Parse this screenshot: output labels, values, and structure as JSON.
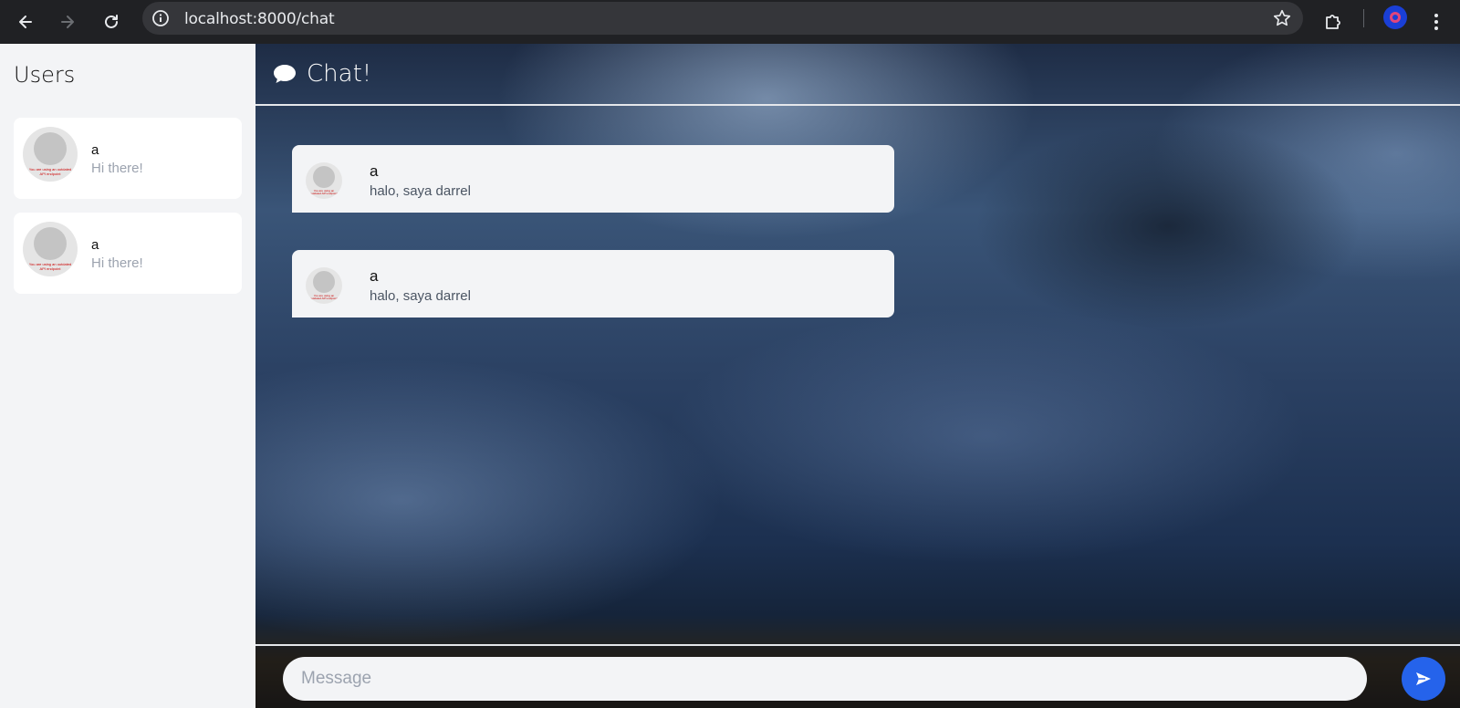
{
  "browser": {
    "url": "localhost:8000/chat",
    "icons": {
      "back": "arrow-left-icon",
      "forward": "arrow-right-icon",
      "reload": "reload-icon",
      "info": "info-icon",
      "bookmark": "star-icon",
      "extensions": "puzzle-icon",
      "menu": "kebab-menu-icon"
    }
  },
  "sidebar": {
    "title": "Users",
    "users": [
      {
        "name": "a",
        "last_message": "Hi there!",
        "avatar_note": "You are using an outdated API endpoint"
      },
      {
        "name": "a",
        "last_message": "Hi there!",
        "avatar_note": "You are using an outdated API endpoint"
      }
    ]
  },
  "chat": {
    "title": "Chat!",
    "messages": [
      {
        "sender": "a",
        "text": "halo, saya darrel"
      },
      {
        "sender": "a",
        "text": "halo, saya darrel"
      }
    ],
    "input_placeholder": "Message",
    "input_value": ""
  },
  "colors": {
    "accent": "#2563eb",
    "sidebar_bg": "#f3f4f6",
    "card_bg": "#ffffff",
    "chrome_bg": "#202124"
  }
}
